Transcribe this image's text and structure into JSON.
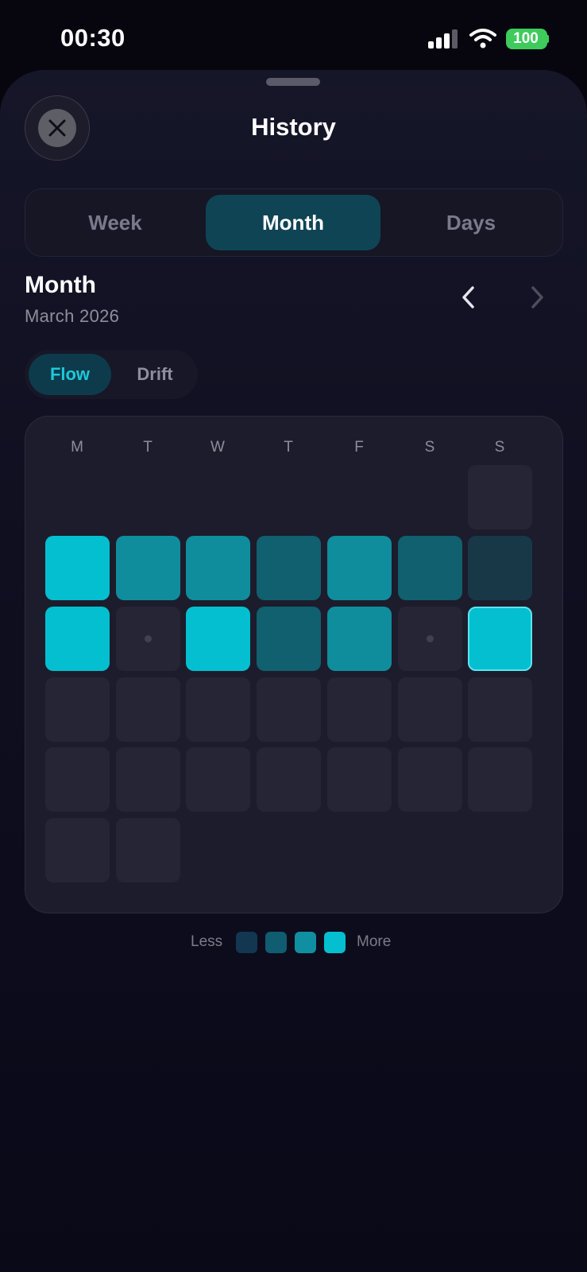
{
  "status_bar": {
    "time": "00:30",
    "battery": "100"
  },
  "sheet": {
    "title": "History"
  },
  "tabs": [
    {
      "label": "Week",
      "active": false
    },
    {
      "label": "Month",
      "active": true
    },
    {
      "label": "Days",
      "active": false
    }
  ],
  "month": {
    "heading": "Month",
    "subtitle": "March 2026"
  },
  "metric_toggle": {
    "flow_label": "Flow",
    "drift_label": "Drift",
    "selected": "Flow"
  },
  "calendar": {
    "weekdays": [
      "M",
      "T",
      "W",
      "T",
      "F",
      "S",
      "S"
    ],
    "weeks": [
      [
        null,
        null,
        null,
        null,
        null,
        null,
        "none"
      ],
      [
        4,
        3,
        3,
        2,
        3,
        2,
        1
      ],
      [
        4,
        "dot",
        4,
        2,
        3,
        "dot",
        "today4"
      ],
      [
        "none",
        "none",
        "none",
        "none",
        "none",
        "none",
        "none"
      ],
      [
        "none",
        "none",
        "none",
        "none",
        "none",
        "none",
        "none"
      ],
      [
        "none",
        "none",
        null,
        null,
        null,
        null,
        null
      ]
    ]
  },
  "legend": {
    "less_label": "Less",
    "more_label": "More",
    "colors": [
      "#133651",
      "#105c70",
      "#108fa2",
      "#04bfcf"
    ]
  },
  "colors": {
    "accent": "#1ec8da",
    "level_1": "#183847",
    "level_2": "#10606f",
    "level_3": "#0f8d9d",
    "level_4": "#04bfcf",
    "empty_cell": "#252535"
  }
}
